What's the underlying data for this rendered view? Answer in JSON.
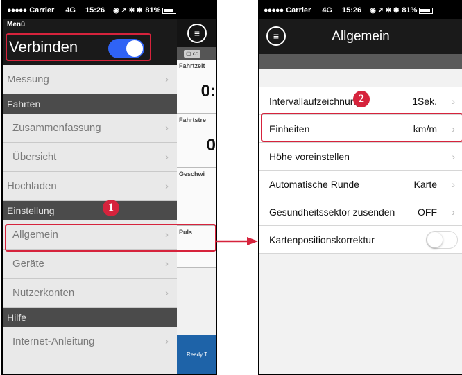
{
  "status_bar": {
    "carrier": "Carrier",
    "network": "4G",
    "time": "15:26",
    "battery": "81%"
  },
  "phone1": {
    "menu_title": "Menü",
    "connect_label": "Verbinden",
    "connect_on": true,
    "items": [
      {
        "type": "row",
        "label": "Messung",
        "indent": 0
      },
      {
        "type": "section",
        "label": "Fahrten"
      },
      {
        "type": "row",
        "label": "Zusammenfassung",
        "indent": 1
      },
      {
        "type": "row",
        "label": "Übersicht",
        "indent": 1
      },
      {
        "type": "row",
        "label": "Hochladen",
        "indent": 0
      },
      {
        "type": "section",
        "label": "Einstellung"
      },
      {
        "type": "row",
        "label": "Allgemein",
        "indent": 1
      },
      {
        "type": "row",
        "label": "Geräte",
        "indent": 1
      },
      {
        "type": "row",
        "label": "Nutzerkonten",
        "indent": 1
      },
      {
        "type": "section",
        "label": "Hilfe"
      },
      {
        "type": "row",
        "label": "Internet-Anleitung",
        "indent": 1
      }
    ],
    "underlay": {
      "tag": "cc",
      "blocks": [
        {
          "label": "Fahrtzeit",
          "value": "0:"
        },
        {
          "label": "Fahrtstre",
          "value": "0"
        },
        {
          "label": "Geschwi",
          "value": ""
        },
        {
          "label": "Puls",
          "value": ""
        }
      ],
      "ready": "Ready T"
    },
    "badge": "1"
  },
  "phone2": {
    "title": "Allgemein",
    "badge": "2",
    "settings": [
      {
        "label": "Intervallaufzeichnung",
        "value": "1Sek."
      },
      {
        "label": "Einheiten",
        "value": "km/m"
      },
      {
        "label": "Höhe voreinstellen",
        "value": ""
      },
      {
        "label": "Automatische Runde",
        "value": "Karte"
      },
      {
        "label": "Gesundheitssektor zusenden",
        "value": "OFF"
      },
      {
        "label": "Kartenpositionskorrektur",
        "value": "",
        "toggle": false
      }
    ]
  },
  "colors": {
    "highlight": "#d6233c",
    "toggle_on": "#2f63f5",
    "ready_bar": "#1e63a8"
  },
  "icons": {
    "menu": "hamburger-circle-icon",
    "chevron": "chevron-right-icon"
  }
}
